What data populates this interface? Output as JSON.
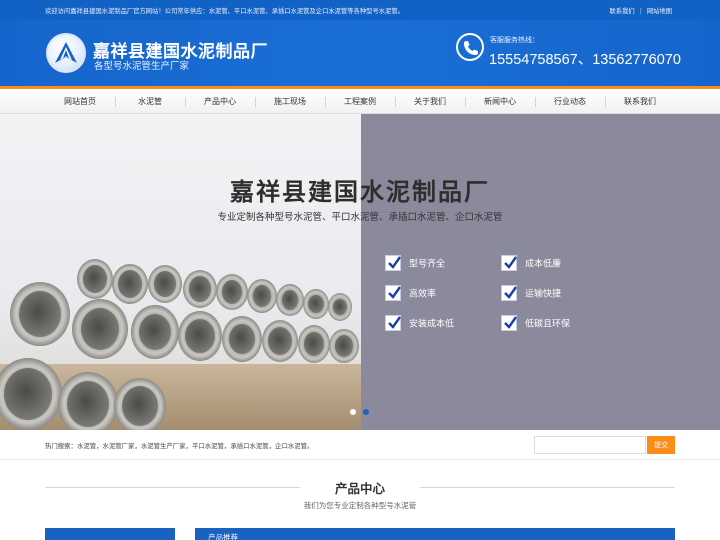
{
  "topbar": {
    "welcome": "欢迎访问嘉祥县建国水泥制品厂官方网站！公司常年供应：水泥管、平口水泥管、承插口水泥管及企口水泥管等各种型号水泥管。",
    "link_contact": "联系我们",
    "link_sitemap": "网站地图"
  },
  "header": {
    "brand": "嘉祥县建国水泥制品厂",
    "slogan": "各型号水泥管生产厂家",
    "hotline_label": "客服服务热线：",
    "hotline_number": "15554758567、13562776070",
    "accent_color": "#1565cc"
  },
  "nav": {
    "items": [
      "网站首页",
      "水泥管",
      "产品中心",
      "施工现场",
      "工程案例",
      "关于我们",
      "新闻中心",
      "行业动态",
      "联系我们"
    ],
    "accent_color": "#fb8c1c"
  },
  "banner": {
    "title": "嘉祥县建国水泥制品厂",
    "subtitle": "专业定制各种型号水泥管、平口水泥管、承插口水泥管、企口水泥管",
    "features": [
      "型号齐全",
      "成本低廉",
      "高效率",
      "运输快捷",
      "安装成本低",
      "低碳且环保"
    ],
    "slide_count": 2,
    "active_slide": 2
  },
  "hotsearch": {
    "text": "热门搜索：水泥管，水泥管厂家，水泥管生产厂家，平口水泥管，承插口水泥管，企口水泥管。",
    "search_placeholder": "",
    "search_button": "提交"
  },
  "products": {
    "title": "产品中心",
    "subtitle": "我们为您专业定制各种型号水泥管",
    "recommend_label": "产品推荐"
  },
  "icons": [
    "logo-emblem-icon",
    "phone-icon",
    "check-icon"
  ]
}
